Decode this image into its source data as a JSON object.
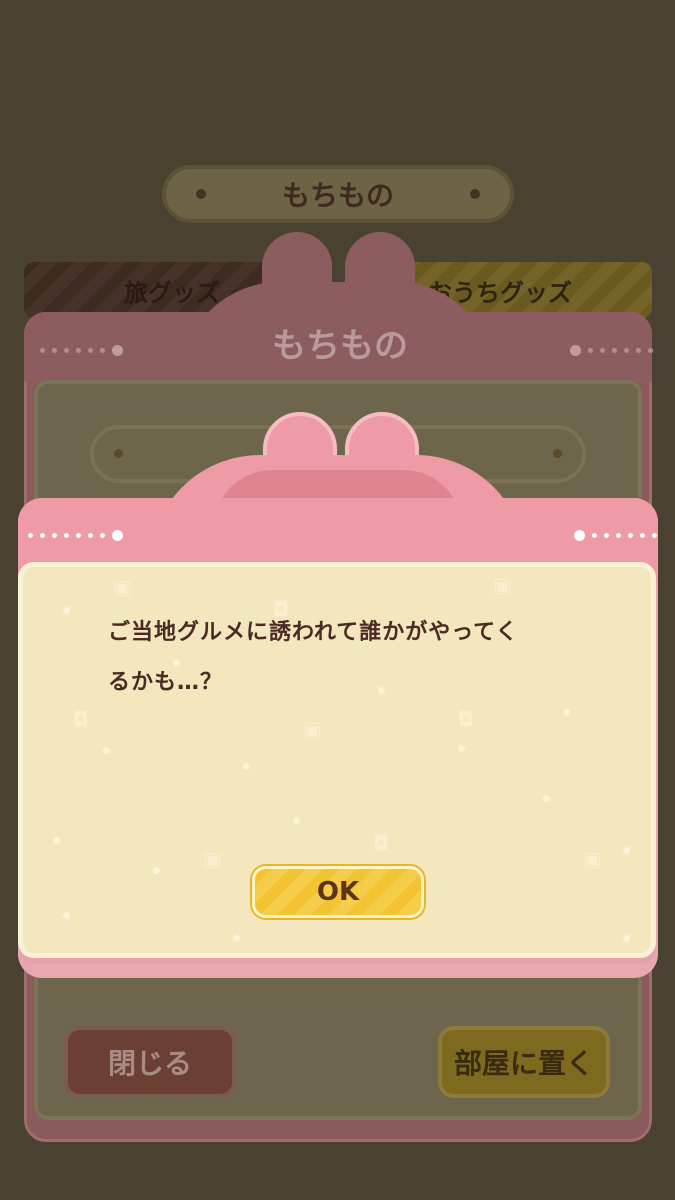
{
  "background": {
    "title": "もちもの",
    "tabs": [
      "旅グッズ",
      "おうちグッズ"
    ]
  },
  "mid_dialog": {
    "title": "もちもの",
    "close_label": "閉じる",
    "place_label": "部屋に置く"
  },
  "popup": {
    "message_line1": "ご当地グルメに誘われて誰かがやってく",
    "message_line2": "るかも…？",
    "ok_label": "OK"
  },
  "colors": {
    "pink": "#ef9aa7",
    "cream": "#f4e6bd",
    "ok_yellow": "#f3c332",
    "text_brown": "#4a2a23"
  }
}
